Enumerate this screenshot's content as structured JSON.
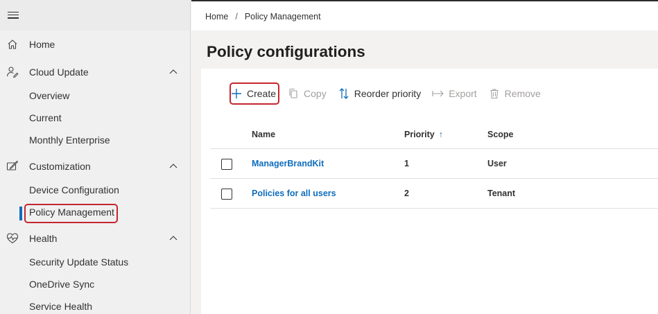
{
  "breadcrumb": {
    "home": "Home",
    "separator": "/",
    "current": "Policy Management"
  },
  "sidebar": {
    "home": {
      "label": "Home",
      "icon": "home-icon"
    },
    "cloud_update": {
      "label": "Cloud Update",
      "icon": "cloud-update-icon",
      "expanded": true,
      "items": [
        "Overview",
        "Current",
        "Monthly Enterprise"
      ]
    },
    "customization": {
      "label": "Customization",
      "icon": "customization-icon",
      "expanded": true,
      "items": [
        "Device Configuration",
        "Policy Management"
      ]
    },
    "health": {
      "label": "Health",
      "icon": "health-icon",
      "expanded": true,
      "items": [
        "Security Update Status",
        "OneDrive Sync",
        "Service Health"
      ]
    },
    "active_item": "Policy Management"
  },
  "page": {
    "title": "Policy configurations"
  },
  "toolbar": {
    "create": "Create",
    "copy": "Copy",
    "reorder": "Reorder priority",
    "export": "Export",
    "remove": "Remove"
  },
  "table": {
    "headers": {
      "name": "Name",
      "priority": "Priority",
      "scope": "Scope",
      "sort_indicator": "↑"
    },
    "rows": [
      {
        "name": "ManagerBrandKit",
        "priority": "1",
        "scope": "User"
      },
      {
        "name": "Policies for all users",
        "priority": "2",
        "scope": "Tenant"
      }
    ]
  },
  "colors": {
    "accent": "#0f6cbd",
    "highlight": "#c4262e",
    "disabled": "#a19f9d"
  }
}
